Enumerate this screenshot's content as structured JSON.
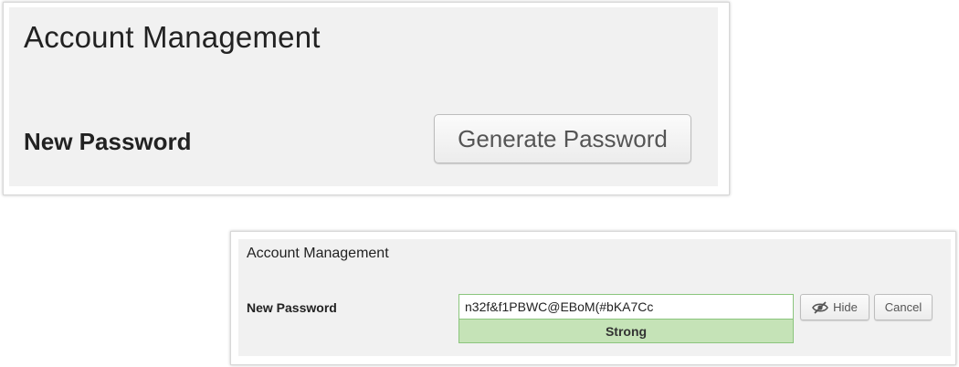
{
  "zoomed": {
    "title": "Account Management",
    "new_password_label": "New Password",
    "generate_button_label": "Generate Password"
  },
  "normal": {
    "title": "Account Management",
    "new_password_label": "New Password",
    "password_value": "n32f&f1PBWC@EBoM(#bKA7Cc",
    "strength_label": "Strong",
    "hide_button_label": "Hide",
    "hide_button_icon": "eye-slash-icon",
    "cancel_button_label": "Cancel"
  },
  "colors": {
    "panel_bg": "#f1f1f1",
    "strength_bg": "#c5e3b7",
    "strength_border": "#8bc57d"
  }
}
